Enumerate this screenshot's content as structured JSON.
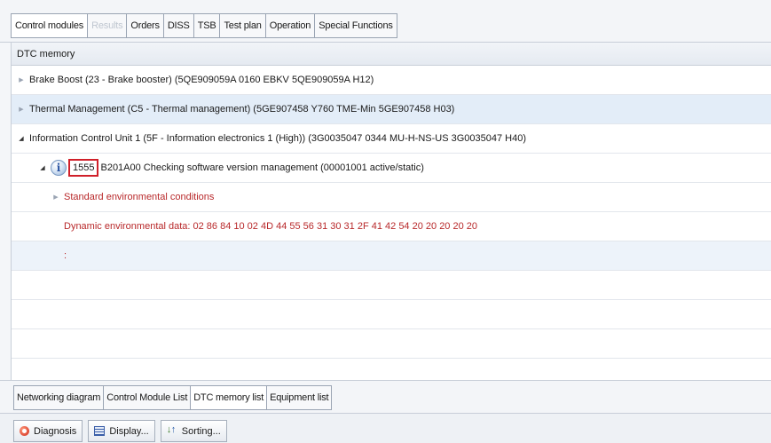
{
  "top_tabs": [
    "Control modules",
    "Results",
    "Orders",
    "DISS",
    "TSB",
    "Test plan",
    "Operation",
    "Special Functions"
  ],
  "panel": {
    "title": "DTC memory",
    "rows": {
      "r1": "Brake Boost (23 - Brake booster) (5QE909059A   0160  EBKV           5QE909059A   H12)",
      "r2": "Thermal Management (C5 - Thermal management) (5GE907458     Y760  TME-Min          5GE907458     H03)",
      "r3": "Information Control Unit 1 (5F - Information electronics 1 (High)) (3G0035047     0344  MU-H-NS-US       3G0035047     H40)",
      "r4": {
        "info_glyph": "i",
        "code": "1555",
        "text": "B201A00   Checking software version management  (00001001   active/static)"
      },
      "r5": "Standard environmental conditions",
      "r6": "Dynamic environmental data: 02 86 84 10 02 4D 44 55 56 31 30 31 2F 41 42 54 20 20 20 20 20",
      "r7": ":"
    }
  },
  "bottom_tabs": [
    "Networking diagram",
    "Control Module List",
    "DTC memory list",
    "Equipment list"
  ],
  "toolbar": {
    "diagnosis": "Diagnosis",
    "display": "Display...",
    "sorting": "Sorting..."
  },
  "colors": {
    "red_text": "#b8282a",
    "highlight_box": "#d0202a",
    "selected_row": "#e3edf8"
  }
}
